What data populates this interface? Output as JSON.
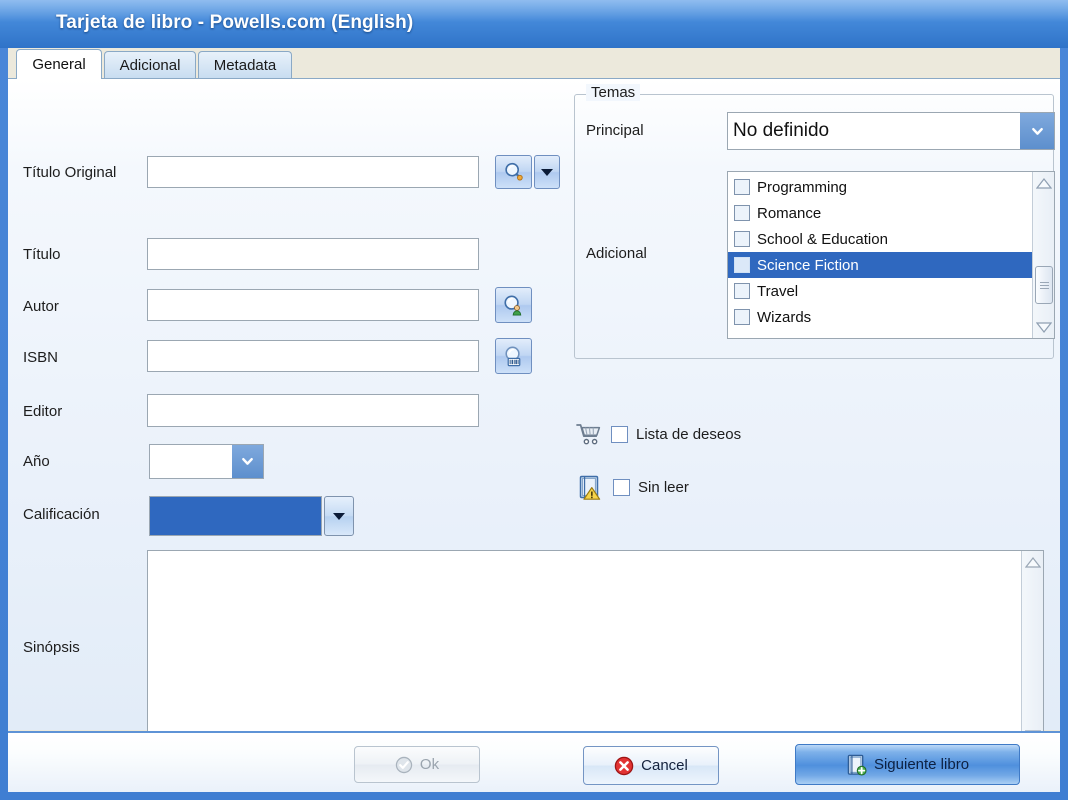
{
  "window": {
    "title": "Tarjeta de libro - Powells.com (English)"
  },
  "tabs": [
    {
      "label": "General",
      "active": true
    },
    {
      "label": "Adicional",
      "active": false
    },
    {
      "label": "Metadata",
      "active": false
    }
  ],
  "form": {
    "titulo_original": {
      "label": "Título Original",
      "value": "",
      "placeholder": ""
    },
    "titulo": {
      "label": "Título",
      "value": "",
      "placeholder": ""
    },
    "autor": {
      "label": "Autor",
      "value": "",
      "placeholder": ""
    },
    "isbn": {
      "label": "ISBN",
      "value": "",
      "placeholder": ""
    },
    "editor": {
      "label": "Editor",
      "value": "",
      "placeholder": ""
    },
    "anio": {
      "label": "Año",
      "value": ""
    },
    "calificacion": {
      "label": "Calificación",
      "value": ""
    },
    "sinopsis": {
      "label": "Sinópsis",
      "value": "",
      "placeholder": ""
    }
  },
  "temas": {
    "legend": "Temas",
    "principal_label": "Principal",
    "principal_value": "No definido",
    "adicional_label": "Adicional",
    "items": [
      {
        "label": "Programming",
        "checked": false,
        "selected": false
      },
      {
        "label": "Romance",
        "checked": false,
        "selected": false
      },
      {
        "label": "School & Education",
        "checked": false,
        "selected": false
      },
      {
        "label": "Science Fiction",
        "checked": false,
        "selected": true
      },
      {
        "label": "Travel",
        "checked": false,
        "selected": false
      },
      {
        "label": "Wizards",
        "checked": false,
        "selected": false
      }
    ]
  },
  "flags": {
    "wishlist": {
      "label": "Lista de deseos",
      "checked": false,
      "icon": "shopping-cart-icon"
    },
    "unread": {
      "label": "Sin leer",
      "checked": false,
      "icon": "book-warning-icon"
    }
  },
  "icons": {
    "search_title": "search-icon",
    "search_title_dropdown": "chevron-down-icon",
    "search_author": "search-person-icon",
    "search_isbn": "search-barcode-icon"
  },
  "buttons": {
    "ok": {
      "label": "Ok",
      "disabled": true,
      "icon": "check-circle-icon"
    },
    "cancel": {
      "label": "Cancel",
      "disabled": false,
      "icon": "error-circle-icon"
    },
    "next": {
      "label": "Siguiente libro",
      "disabled": false,
      "icon": "book-add-icon"
    }
  },
  "colors": {
    "titlebar": "#4388d9",
    "selection": "#2f68bf",
    "accent": "#5e93d6",
    "tabstrip": "#ece9dc"
  }
}
